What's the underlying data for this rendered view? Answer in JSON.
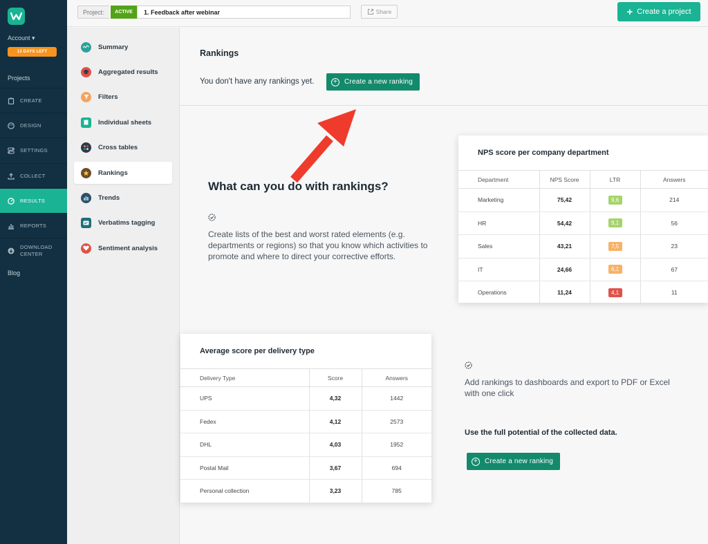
{
  "app": {
    "account_label": "Account ▾",
    "trial_badge": "13 DAYS LEFT",
    "projects_label": "Projects",
    "blog_label": "Blog"
  },
  "leftnav": [
    {
      "label": "CREATE",
      "icon": "clipboard-icon"
    },
    {
      "label": "DESIGN",
      "icon": "palette-icon"
    },
    {
      "label": "SETTINGS",
      "icon": "toggles-icon"
    },
    {
      "label": "COLLECT",
      "icon": "upload-icon"
    },
    {
      "label": "RESULTS",
      "icon": "gauge-icon",
      "active": true
    },
    {
      "label": "REPORTS",
      "icon": "bar-chart-icon"
    },
    {
      "label": "DOWNLOAD CENTER",
      "icon": "download-icon"
    }
  ],
  "topbar": {
    "project_label": "Project:",
    "status": "ACTIVE",
    "project_name": "1. Feedback after webinar",
    "share_label": "Share",
    "create_project_label": "Create a project"
  },
  "subnav": [
    {
      "label": "Summary",
      "color": "#2aa39a",
      "icon": "summary-icon"
    },
    {
      "label": "Aggregated results",
      "color": "#e0524a",
      "icon": "aggregated-icon"
    },
    {
      "label": "Filters",
      "color": "#f5a35c",
      "icon": "filter-icon"
    },
    {
      "label": "Individual sheets",
      "color": "#1ab394",
      "icon": "sheet-icon"
    },
    {
      "label": "Cross tables",
      "color": "#2d3a4a",
      "icon": "cross-tables-icon"
    },
    {
      "label": "Rankings",
      "color": "#6b4a2b",
      "icon": "star-icon",
      "active": true
    },
    {
      "label": "Trends",
      "color": "#2d4e6a",
      "icon": "trends-icon"
    },
    {
      "label": "Verbatims tagging",
      "color": "#1f6f7a",
      "icon": "tag-icon"
    },
    {
      "label": "Sentiment analysis",
      "color": "#e0524a",
      "icon": "heart-icon"
    }
  ],
  "main": {
    "title": "Rankings",
    "no_rankings": "You don't have any rankings yet.",
    "create_ranking_label": "Create a new ranking",
    "what_title": "What can you do with rankings?",
    "desc1": "Create lists of the best and worst rated elements (e.g. departments or regions) so that you know which activities to promote and where to direct your corrective efforts.",
    "desc2": "Add rankings to dashboards and export to PDF or Excel with one click",
    "full_potential": "Use the full potential of the collected data.",
    "create_ranking_label_2": "Create a new ranking"
  },
  "nps_card": {
    "title": "NPS score per company department",
    "headers": [
      "Department",
      "NPS Score",
      "LTR",
      "Answers"
    ],
    "rows": [
      {
        "dept": "Marketing",
        "nps": "75,42",
        "ltr": "9,6",
        "ltr_color": "#a5d46a",
        "answers": "214"
      },
      {
        "dept": "HR",
        "nps": "54,42",
        "ltr": "9,1",
        "ltr_color": "#a5d46a",
        "answers": "56"
      },
      {
        "dept": "Sales",
        "nps": "43,21",
        "ltr": "7,5",
        "ltr_color": "#f7b267",
        "answers": "23"
      },
      {
        "dept": "IT",
        "nps": "24,66",
        "ltr": "6,1",
        "ltr_color": "#f7b267",
        "answers": "67"
      },
      {
        "dept": "Operations",
        "nps": "11,24",
        "ltr": "4,1",
        "ltr_color": "#e0524a",
        "answers": "11"
      }
    ]
  },
  "delivery_card": {
    "title": "Average score per delivery type",
    "headers": [
      "Delivery Type",
      "Score",
      "Answers"
    ],
    "rows": [
      {
        "type": "UPS",
        "score": "4,32",
        "answers": "1442"
      },
      {
        "type": "Fedex",
        "score": "4,12",
        "answers": "2573"
      },
      {
        "type": "DHL",
        "score": "4,03",
        "answers": "1952"
      },
      {
        "type": "Postal Mail",
        "score": "3,67",
        "answers": "694"
      },
      {
        "type": "Personal collection",
        "score": "3,23",
        "answers": "785"
      }
    ]
  }
}
